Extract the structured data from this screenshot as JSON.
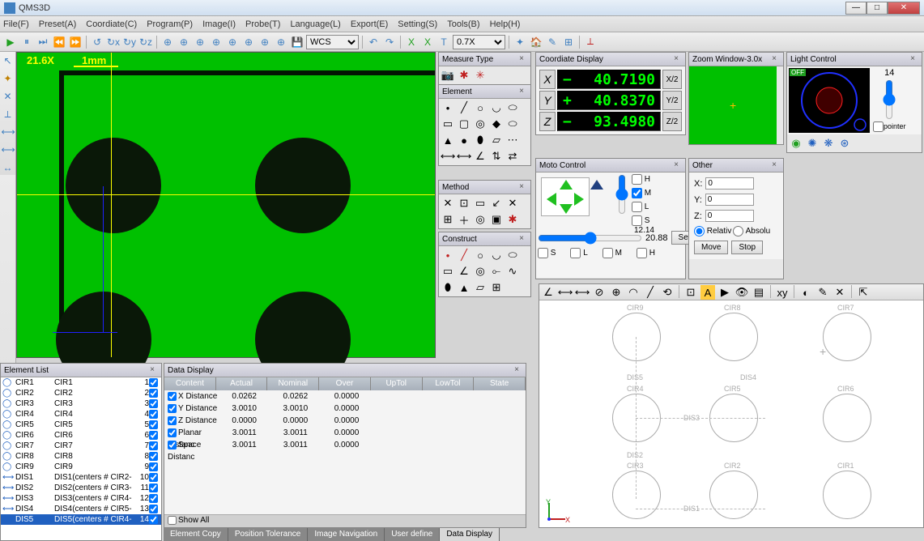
{
  "title": "QMS3D",
  "menu": [
    "File(F)",
    "Preset(A)",
    "Coordiate(C)",
    "Program(P)",
    "Image(I)",
    "Probe(T)",
    "Language(L)",
    "Export(E)",
    "Setting(S)",
    "Tools(B)",
    "Help(H)"
  ],
  "wcs_label": "WCS",
  "zoom_scale": "0.7X",
  "video": {
    "zoom": "21.6X",
    "scale": "1mm"
  },
  "panels": {
    "measure_type": "Measure Type",
    "element": "Element",
    "method": "Method",
    "construct": "Construct",
    "coord": "Coordiate Display",
    "moto": "Moto Control",
    "other": "Other",
    "zoom": "Zoom Window-3.0x",
    "light": "Light Control",
    "element_list": "Element List",
    "data_display": "Data Display"
  },
  "coords": {
    "x": {
      "label": "X",
      "value": "40.7190",
      "sign": "neg",
      "btn": "X/2"
    },
    "y": {
      "label": "Y",
      "value": "40.8370",
      "sign": "pos",
      "btn": "Y/2"
    },
    "z": {
      "label": "Z",
      "value": "93.4980",
      "sign": "neg",
      "btn": "Z/2"
    }
  },
  "moto": {
    "cb_h": "H",
    "cb_m": "M",
    "cb_l": "L",
    "cb_s": "S",
    "speed1": "12.14",
    "speed2": "20.88",
    "setting": "Setting",
    "s": "S",
    "m2": "M",
    "h2": "H"
  },
  "other": {
    "x_lbl": "X:",
    "x_val": "0",
    "y_lbl": "Y:",
    "y_val": "0",
    "z_lbl": "Z:",
    "z_val": "0",
    "rel": "Relativ",
    "abs": "Absolu",
    "move": "Move",
    "stop": "Stop"
  },
  "light": {
    "val": "14",
    "pointer": "pointer"
  },
  "element_list": {
    "items": [
      {
        "icon": "circle",
        "c1": "CIR1",
        "c2": "CIR1",
        "n": "1"
      },
      {
        "icon": "circle",
        "c1": "CIR2",
        "c2": "CIR2",
        "n": "2"
      },
      {
        "icon": "circle",
        "c1": "CIR3",
        "c2": "CIR3",
        "n": "3"
      },
      {
        "icon": "circle",
        "c1": "CIR4",
        "c2": "CIR4",
        "n": "4"
      },
      {
        "icon": "circle",
        "c1": "CIR5",
        "c2": "CIR5",
        "n": "5"
      },
      {
        "icon": "circle",
        "c1": "CIR6",
        "c2": "CIR6",
        "n": "6"
      },
      {
        "icon": "circle",
        "c1": "CIR7",
        "c2": "CIR7",
        "n": "7"
      },
      {
        "icon": "circle",
        "c1": "CIR8",
        "c2": "CIR8",
        "n": "8"
      },
      {
        "icon": "circle",
        "c1": "CIR9",
        "c2": "CIR9",
        "n": "9"
      },
      {
        "icon": "dist",
        "c1": "DIS1",
        "c2": "DIS1(centers # CIR2-",
        "n": "10"
      },
      {
        "icon": "dist",
        "c1": "DIS2",
        "c2": "DIS2(centers # CIR3-",
        "n": "11"
      },
      {
        "icon": "dist",
        "c1": "DIS3",
        "c2": "DIS3(centers # CIR4-",
        "n": "12"
      },
      {
        "icon": "dist",
        "c1": "DIS4",
        "c2": "DIS4(centers # CIR5-",
        "n": "13"
      },
      {
        "icon": "dist",
        "c1": "DIS5",
        "c2": "DIS5(centers # CIR4-",
        "n": "14",
        "sel": true
      }
    ]
  },
  "data_display": {
    "headers": [
      "Content",
      "Actual",
      "Nominal",
      "Over",
      "UpTol",
      "LowTol",
      "State"
    ],
    "rows": [
      {
        "c": "X Distance",
        "a": "0.0262",
        "n": "0.0262",
        "o": "0.0000"
      },
      {
        "c": "Y Distance",
        "a": "3.0010",
        "n": "3.0010",
        "o": "0.0000"
      },
      {
        "c": "Z Distance",
        "a": "0.0000",
        "n": "0.0000",
        "o": "0.0000"
      },
      {
        "c": "Planar Distanc",
        "a": "3.0011",
        "n": "3.0011",
        "o": "0.0000"
      },
      {
        "c": "Space Distanc",
        "a": "3.0011",
        "n": "3.0011",
        "o": "0.0000"
      }
    ],
    "show_all": "Show All"
  },
  "bottom_tabs": [
    "Element Copy",
    "Position Tolerance",
    "Image Navigation",
    "User define",
    "Data Display"
  ],
  "model_labels": {
    "cir1": "CIR1",
    "cir2": "CIR2",
    "cir3": "CIR3",
    "cir4": "CIR4",
    "cir5": "CIR5",
    "cir6": "CIR6",
    "cir7": "CIR7",
    "cir8": "CIR8",
    "cir9": "CIR9",
    "dis1": "DIS1",
    "dis2": "DIS2",
    "dis3": "DIS3",
    "dis4": "DIS4",
    "dis5": "DIS5",
    "axis_x": "X",
    "axis_y": "Y"
  }
}
